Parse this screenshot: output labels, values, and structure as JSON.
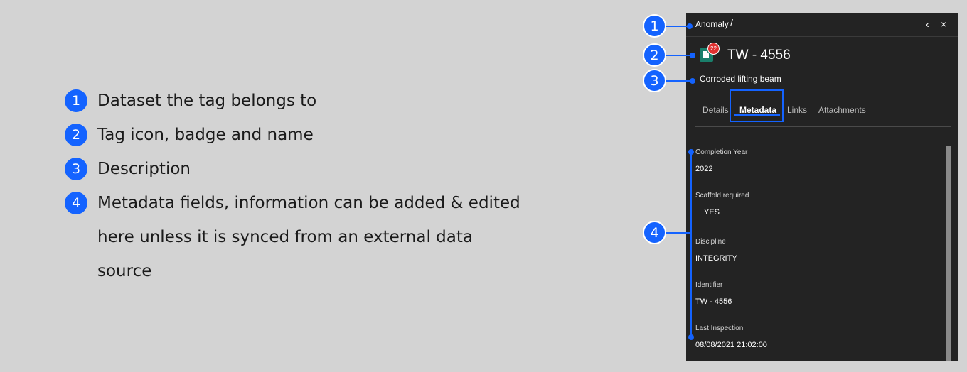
{
  "legend": {
    "items": [
      {
        "number": "1",
        "text": "Dataset the tag belongs to"
      },
      {
        "number": "2",
        "text": "Tag icon, badge and name"
      },
      {
        "number": "3",
        "text": "Description"
      },
      {
        "number": "4",
        "text": "Metadata fields, information can be added & edited",
        "cont1": "here unless it is synced from an external data",
        "cont2": "source"
      }
    ]
  },
  "callouts": [
    "1",
    "2",
    "3",
    "4"
  ],
  "panel": {
    "breadcrumb": "Anomaly",
    "breadcrumb_sep": "/",
    "back_icon": "‹",
    "close_icon": "×",
    "tag": {
      "badge": "22",
      "name": "TW - 4556"
    },
    "description": "Corroded lifting beam",
    "tabs": [
      {
        "label": "Details"
      },
      {
        "label": "Metadata",
        "active": true
      },
      {
        "label": "Links"
      },
      {
        "label": "Attachments"
      }
    ],
    "fields": [
      {
        "label": "Completion Year",
        "value": "2022"
      },
      {
        "label": "Scaffold required",
        "value": "YES"
      },
      {
        "label": "Discipline",
        "value": "INTEGRITY"
      },
      {
        "label": "Identifier",
        "value": "TW - 4556"
      },
      {
        "label": "Last Inspection",
        "value": "08/08/2021 21:02:00"
      }
    ]
  },
  "colors": {
    "accent": "#1463ff",
    "panel_bg": "#232323",
    "badge": "#e03131",
    "tag_icon": "#1a7f6b",
    "page_bg": "#d3d3d3"
  }
}
